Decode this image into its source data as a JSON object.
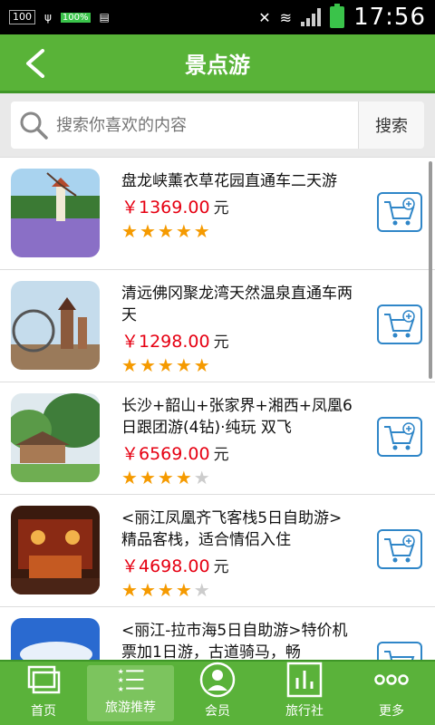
{
  "status_bar": {
    "left_items": [
      "100",
      "100%"
    ],
    "time": "17:56"
  },
  "header": {
    "title": "景点游"
  },
  "search": {
    "placeholder": "搜索你喜欢的内容",
    "button_label": "搜索"
  },
  "items": [
    {
      "name": "盘龙峡薰衣草花园直通车二天游",
      "price": "￥1369.00",
      "unit": "元",
      "rating": 5
    },
    {
      "name": "清远佛冈聚龙湾天然温泉直通车两天",
      "price": "￥1298.00",
      "unit": "元",
      "rating": 5
    },
    {
      "name": "长沙+韶山+张家界+湘西+凤凰6日跟团游(4钻)·纯玩 双飞",
      "price": "￥6569.00",
      "unit": "元",
      "rating": 4
    },
    {
      "name": "<丽江凤凰齐飞客栈5日自助游>精品客栈，适合情侣入住",
      "price": "￥4698.00",
      "unit": "元",
      "rating": 4
    },
    {
      "name": "<丽江-拉市海5日自助游>特价机票加1日游，古道骑马，畅",
      "price": "",
      "unit": "",
      "rating": 0
    }
  ],
  "tabs": [
    {
      "label": "首页"
    },
    {
      "label": "旅游推荐"
    },
    {
      "label": "会员"
    },
    {
      "label": "旅行社"
    },
    {
      "label": "更多"
    }
  ],
  "colors": {
    "brand_green": "#59b338",
    "price_red": "#e60012",
    "star_orange": "#f59a00",
    "cart_blue": "#2f86c8"
  }
}
